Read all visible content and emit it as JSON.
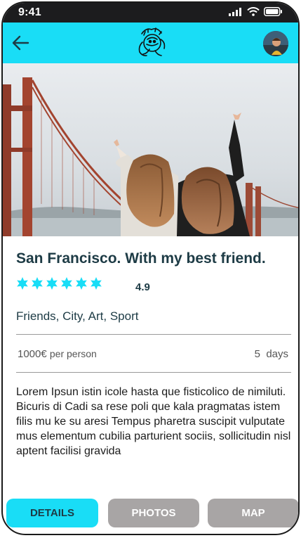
{
  "status": {
    "time": "9:41"
  },
  "header": {
    "back_icon": "arrow-left-icon",
    "logo": "travel-logo"
  },
  "trip": {
    "title": "San Francisco. With my best friend.",
    "star_count": 6,
    "rating": "4.9",
    "tags": "Friends, City, Art, Sport",
    "price": "1000€",
    "price_unit": "per person",
    "duration_value": "5",
    "duration_unit": "days",
    "description": "Lorem Ipsun istin icole hasta que fisticolico de nimiluti. Bicuris di Cadi sa rese poli que kala pragmatas istem filis mu ke su aresi Tempus pharetra suscipit vulputate mus elementum cubilia parturient sociis, sollicitudin nisl aptent facilisi gravida"
  },
  "tabs": {
    "details": "DETAILS",
    "photos": "PHOTOS",
    "map": "MAP"
  },
  "colors": {
    "accent": "#19ddf6",
    "title": "#1d3b45",
    "inactive_tab": "#a8a5a5"
  }
}
